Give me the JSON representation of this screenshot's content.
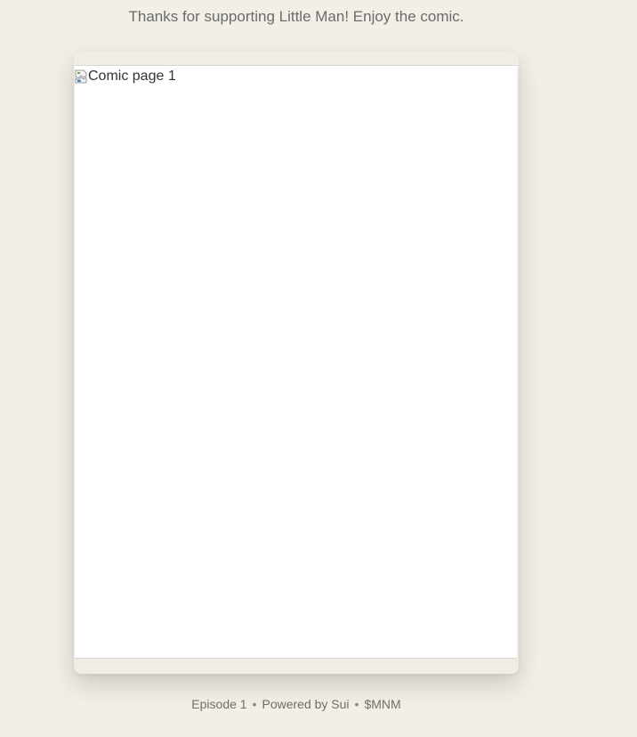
{
  "header": {
    "thanks_text": "Thanks for supporting Little Man! Enjoy the comic."
  },
  "viewer": {
    "page_alt": "Comic page 1",
    "broken_image_icon": "broken-image-icon"
  },
  "footer": {
    "episode": "Episode 1",
    "powered_by": "Powered by Sui",
    "ticker": "$MNM",
    "separator": "•"
  },
  "colors": {
    "background": "#f2efe7",
    "viewer_bg": "#f0ede5",
    "page_bg": "#ffffff",
    "text_muted": "#6b6b6b"
  }
}
